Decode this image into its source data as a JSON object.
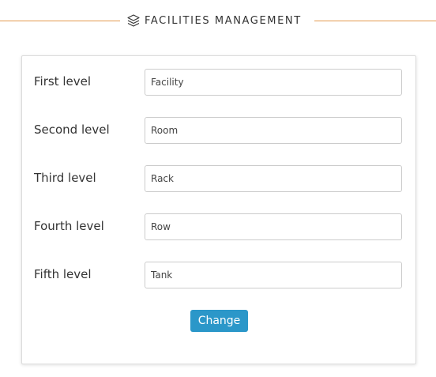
{
  "header": {
    "title": "FACILITIES MANAGEMENT",
    "icon": "layers-icon",
    "line_color": "#e39b4f"
  },
  "levels": [
    {
      "label": "First level",
      "value": "Facility"
    },
    {
      "label": "Second level",
      "value": "Room"
    },
    {
      "label": "Third level",
      "value": "Rack"
    },
    {
      "label": "Fourth level",
      "value": "Row"
    },
    {
      "label": "Fifth level",
      "value": "Tank"
    }
  ],
  "actions": {
    "change_label": "Change",
    "button_color": "#2b97c9"
  }
}
